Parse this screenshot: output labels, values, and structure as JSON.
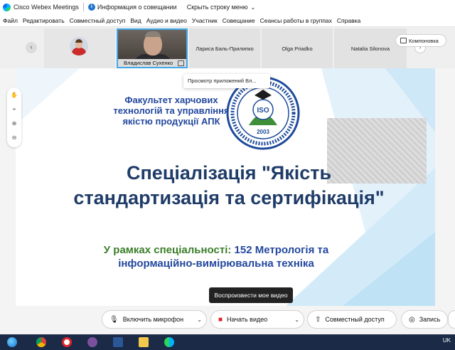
{
  "titlebar": {
    "app_name": "Cisco Webex Meetings",
    "meeting_info": "Информация о совещании",
    "hide_menu": "Скрыть строку меню"
  },
  "menu": [
    "Файл",
    "Редактировать",
    "Совместный доступ",
    "Вид",
    "Аудио и видео",
    "Участник",
    "Совещание",
    "Сеансы работы в группах",
    "Справка"
  ],
  "participants": {
    "active_name": "Владислав Сухенко",
    "p3": "Лариса Баль-Прилипко",
    "p4": "Olga Priadko",
    "p5": "Natalia Silonova"
  },
  "layout_label": "Компоновка",
  "apps_tooltip": "Просмотр приложений Вл...",
  "slide": {
    "faculty": "Факультет харчових технологій та управління якістю продукції АПК",
    "seal_iso": "ISO",
    "seal_year": "2003",
    "specialization": "Спеціалізація \"Якість стандартизація та сертифікація\"",
    "within_green": "У рамках спеціальності: ",
    "within_blue": "152 Метрологія та інформаційно-вимірювальна техніка"
  },
  "play_tooltip": "Воспроизвести мое видео",
  "controls": {
    "mic": "Включить микрофон",
    "video": "Начать видео",
    "share": "Совместный доступ",
    "record": "Запись"
  },
  "taskbar": {
    "lang": "UK"
  },
  "icons": {
    "mic": "mic-icon",
    "video": "video-camera-icon",
    "share": "share-screen-icon",
    "record": "record-icon"
  }
}
